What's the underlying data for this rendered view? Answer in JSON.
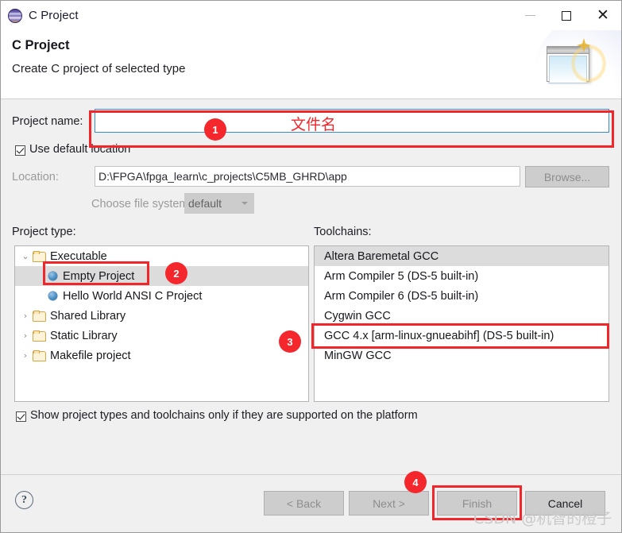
{
  "window": {
    "title": "C Project",
    "icon": "eclipse-icon",
    "buttons": {
      "minimize": "minimize-icon",
      "maximize": "maximize-icon",
      "close": "close-icon"
    }
  },
  "header": {
    "title": "C Project",
    "subtitle": "Create C project of selected type",
    "art": "new-project-wizard-banner-icon"
  },
  "form": {
    "project_name_label": "Project name:",
    "project_name_value": "",
    "project_name_placeholder": "",
    "use_default_location_label": "Use default location",
    "use_default_location_checked": true,
    "location_label": "Location:",
    "location_value": "D:\\FPGA\\fpga_learn\\c_projects\\C5MB_GHRD\\app",
    "browse_label": "Browse...",
    "choose_file_system_label": "Choose file system:",
    "file_system_value": "default",
    "file_system_options": [
      "default"
    ]
  },
  "project_type": {
    "label": "Project type:",
    "items": [
      {
        "label": "Executable",
        "kind": "folder",
        "depth": 0,
        "expanded": true,
        "twisty": "⌄",
        "selected": false
      },
      {
        "label": "Empty Project",
        "kind": "leaf",
        "depth": 1,
        "expanded": false,
        "twisty": "",
        "selected": true
      },
      {
        "label": "Hello World ANSI C Project",
        "kind": "leaf",
        "depth": 1,
        "expanded": false,
        "twisty": "",
        "selected": false
      },
      {
        "label": "Shared Library",
        "kind": "folder",
        "depth": 0,
        "expanded": false,
        "twisty": "›",
        "selected": false
      },
      {
        "label": "Static Library",
        "kind": "folder",
        "depth": 0,
        "expanded": false,
        "twisty": "›",
        "selected": false
      },
      {
        "label": "Makefile project",
        "kind": "folder",
        "depth": 0,
        "expanded": false,
        "twisty": "›",
        "selected": false
      }
    ]
  },
  "toolchains": {
    "label": "Toolchains:",
    "items": [
      {
        "label": "Altera Baremetal GCC",
        "selected": true
      },
      {
        "label": "Arm Compiler 5 (DS-5 built-in)",
        "selected": false
      },
      {
        "label": "Arm Compiler 6 (DS-5 built-in)",
        "selected": false
      },
      {
        "label": "Cygwin GCC",
        "selected": false
      },
      {
        "label": "GCC 4.x [arm-linux-gnueabihf] (DS-5 built-in)",
        "selected": false
      },
      {
        "label": "MinGW GCC",
        "selected": false
      }
    ]
  },
  "show_supported": {
    "label": "Show project types and toolchains only if they are supported on the platform",
    "checked": true
  },
  "footer": {
    "help_label": "?",
    "back_label": "< Back",
    "next_label": "Next >",
    "finish_label": "Finish",
    "cancel_label": "Cancel"
  },
  "annotations": {
    "accent_color": "#f0262a",
    "badge_color": "#f4282c",
    "badges": [
      "1",
      "2",
      "3",
      "4"
    ],
    "note_project_name": "文件名",
    "watermark": "CSDN @机智的橙子"
  }
}
